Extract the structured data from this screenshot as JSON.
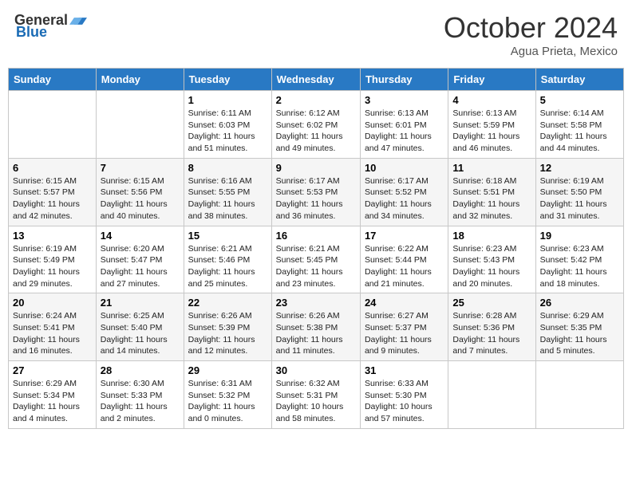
{
  "header": {
    "logo_general": "General",
    "logo_blue": "Blue",
    "month_year": "October 2024",
    "location": "Agua Prieta, Mexico"
  },
  "days_of_week": [
    "Sunday",
    "Monday",
    "Tuesday",
    "Wednesday",
    "Thursday",
    "Friday",
    "Saturday"
  ],
  "weeks": [
    [
      {
        "day": "",
        "content": ""
      },
      {
        "day": "",
        "content": ""
      },
      {
        "day": "1",
        "content": "Sunrise: 6:11 AM\nSunset: 6:03 PM\nDaylight: 11 hours and 51 minutes."
      },
      {
        "day": "2",
        "content": "Sunrise: 6:12 AM\nSunset: 6:02 PM\nDaylight: 11 hours and 49 minutes."
      },
      {
        "day": "3",
        "content": "Sunrise: 6:13 AM\nSunset: 6:01 PM\nDaylight: 11 hours and 47 minutes."
      },
      {
        "day": "4",
        "content": "Sunrise: 6:13 AM\nSunset: 5:59 PM\nDaylight: 11 hours and 46 minutes."
      },
      {
        "day": "5",
        "content": "Sunrise: 6:14 AM\nSunset: 5:58 PM\nDaylight: 11 hours and 44 minutes."
      }
    ],
    [
      {
        "day": "6",
        "content": "Sunrise: 6:15 AM\nSunset: 5:57 PM\nDaylight: 11 hours and 42 minutes."
      },
      {
        "day": "7",
        "content": "Sunrise: 6:15 AM\nSunset: 5:56 PM\nDaylight: 11 hours and 40 minutes."
      },
      {
        "day": "8",
        "content": "Sunrise: 6:16 AM\nSunset: 5:55 PM\nDaylight: 11 hours and 38 minutes."
      },
      {
        "day": "9",
        "content": "Sunrise: 6:17 AM\nSunset: 5:53 PM\nDaylight: 11 hours and 36 minutes."
      },
      {
        "day": "10",
        "content": "Sunrise: 6:17 AM\nSunset: 5:52 PM\nDaylight: 11 hours and 34 minutes."
      },
      {
        "day": "11",
        "content": "Sunrise: 6:18 AM\nSunset: 5:51 PM\nDaylight: 11 hours and 32 minutes."
      },
      {
        "day": "12",
        "content": "Sunrise: 6:19 AM\nSunset: 5:50 PM\nDaylight: 11 hours and 31 minutes."
      }
    ],
    [
      {
        "day": "13",
        "content": "Sunrise: 6:19 AM\nSunset: 5:49 PM\nDaylight: 11 hours and 29 minutes."
      },
      {
        "day": "14",
        "content": "Sunrise: 6:20 AM\nSunset: 5:47 PM\nDaylight: 11 hours and 27 minutes."
      },
      {
        "day": "15",
        "content": "Sunrise: 6:21 AM\nSunset: 5:46 PM\nDaylight: 11 hours and 25 minutes."
      },
      {
        "day": "16",
        "content": "Sunrise: 6:21 AM\nSunset: 5:45 PM\nDaylight: 11 hours and 23 minutes."
      },
      {
        "day": "17",
        "content": "Sunrise: 6:22 AM\nSunset: 5:44 PM\nDaylight: 11 hours and 21 minutes."
      },
      {
        "day": "18",
        "content": "Sunrise: 6:23 AM\nSunset: 5:43 PM\nDaylight: 11 hours and 20 minutes."
      },
      {
        "day": "19",
        "content": "Sunrise: 6:23 AM\nSunset: 5:42 PM\nDaylight: 11 hours and 18 minutes."
      }
    ],
    [
      {
        "day": "20",
        "content": "Sunrise: 6:24 AM\nSunset: 5:41 PM\nDaylight: 11 hours and 16 minutes."
      },
      {
        "day": "21",
        "content": "Sunrise: 6:25 AM\nSunset: 5:40 PM\nDaylight: 11 hours and 14 minutes."
      },
      {
        "day": "22",
        "content": "Sunrise: 6:26 AM\nSunset: 5:39 PM\nDaylight: 11 hours and 12 minutes."
      },
      {
        "day": "23",
        "content": "Sunrise: 6:26 AM\nSunset: 5:38 PM\nDaylight: 11 hours and 11 minutes."
      },
      {
        "day": "24",
        "content": "Sunrise: 6:27 AM\nSunset: 5:37 PM\nDaylight: 11 hours and 9 minutes."
      },
      {
        "day": "25",
        "content": "Sunrise: 6:28 AM\nSunset: 5:36 PM\nDaylight: 11 hours and 7 minutes."
      },
      {
        "day": "26",
        "content": "Sunrise: 6:29 AM\nSunset: 5:35 PM\nDaylight: 11 hours and 5 minutes."
      }
    ],
    [
      {
        "day": "27",
        "content": "Sunrise: 6:29 AM\nSunset: 5:34 PM\nDaylight: 11 hours and 4 minutes."
      },
      {
        "day": "28",
        "content": "Sunrise: 6:30 AM\nSunset: 5:33 PM\nDaylight: 11 hours and 2 minutes."
      },
      {
        "day": "29",
        "content": "Sunrise: 6:31 AM\nSunset: 5:32 PM\nDaylight: 11 hours and 0 minutes."
      },
      {
        "day": "30",
        "content": "Sunrise: 6:32 AM\nSunset: 5:31 PM\nDaylight: 10 hours and 58 minutes."
      },
      {
        "day": "31",
        "content": "Sunrise: 6:33 AM\nSunset: 5:30 PM\nDaylight: 10 hours and 57 minutes."
      },
      {
        "day": "",
        "content": ""
      },
      {
        "day": "",
        "content": ""
      }
    ]
  ]
}
